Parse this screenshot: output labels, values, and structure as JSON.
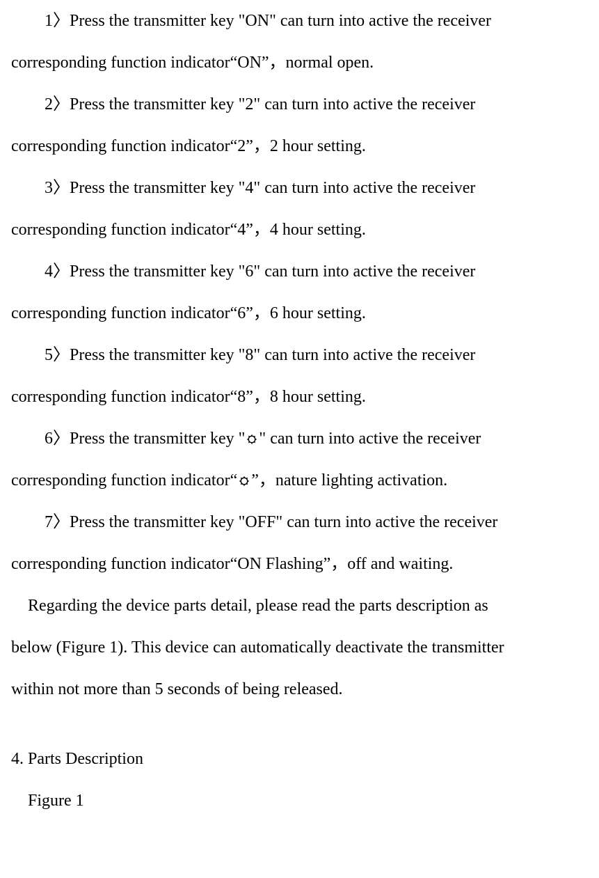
{
  "items": [
    {
      "line1": "1〉Press the transmitter key \"ON\" can turn into active the receiver",
      "line2_pre": "corresponding function indicator“ON”，normal open."
    },
    {
      "line1": "2〉Press the transmitter key \"2\" can turn into active the receiver",
      "line2_pre": "corresponding function indicator“2”，2 hour setting."
    },
    {
      "line1": "3〉Press the transmitter key \"4\" can turn into active the receiver",
      "line2_pre": "corresponding function indicator“4”，4 hour setting."
    },
    {
      "line1": "4〉Press the transmitter key \"6\" can turn into active the receiver",
      "line2_pre": "corresponding function indicator“6”，6 hour setting."
    },
    {
      "line1": "5〉Press the transmitter key \"8\" can turn into active the receiver",
      "line2_pre": "corresponding function indicator“8”，8 hour setting."
    },
    {
      "line1_pre": "6〉Press the transmitter key \"",
      "line1_post": "\" can turn into active the receiver",
      "line2_pre": "corresponding function indicator“",
      "line2_post": "”，nature lighting activation.",
      "has_icon": true
    },
    {
      "line1": "7〉Press the transmitter key \"OFF\" can turn into active the receiver",
      "line2_pre": "corresponding function indicator“ON Flashing”，off and waiting."
    }
  ],
  "paragraph": {
    "line1": "Regarding the device parts detail, please read the parts description as",
    "line2": "below (Figure 1). This device can automatically deactivate the transmitter",
    "line3": "within not more than 5 seconds of being released."
  },
  "heading": "4. Parts Description",
  "figure_label": "Figure 1"
}
